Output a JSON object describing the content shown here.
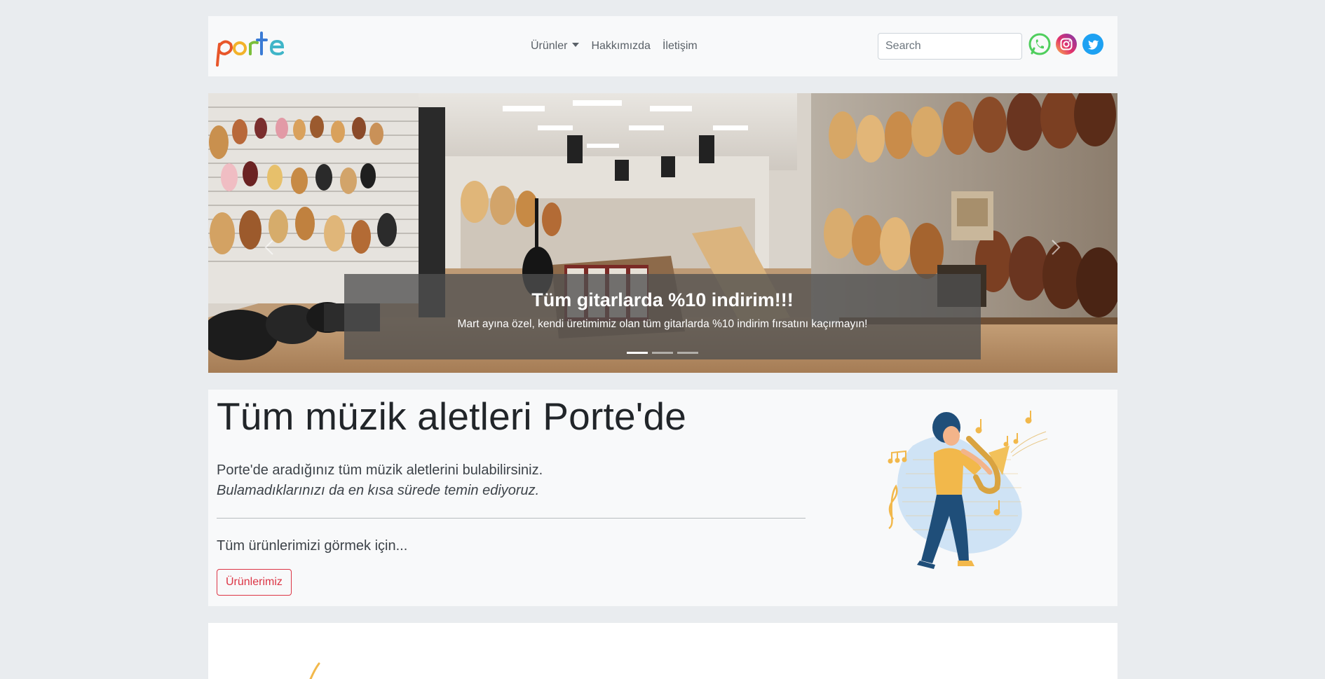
{
  "brand": {
    "logo_text": "Porte"
  },
  "nav": {
    "items": [
      {
        "label": "Ürünler",
        "dropdown": true
      },
      {
        "label": "Hakkımızda",
        "dropdown": false
      },
      {
        "label": "İletişim",
        "dropdown": false
      }
    ],
    "search_placeholder": "Search",
    "social": [
      "whatsapp-icon",
      "instagram-icon",
      "twitter-icon"
    ]
  },
  "carousel": {
    "caption_title": "Tüm gitarlarda %10 indirim!!!",
    "caption_text": "Mart ayına özel, kendi üretimimiz olan tüm gitarlarda %10 indirim fırsatını kaçırmayın!",
    "slide_count": 3,
    "active_index": 0
  },
  "jumbotron": {
    "title": "Tüm müzik aletleri Porte'de",
    "lead1": "Porte'de aradığınız tüm müzik aletlerini bulabilirsiniz.",
    "lead2": "Bulamadıklarınızı da en kısa sürede temin ediyoruz.",
    "lead3": "Tüm ürünlerimizi görmek için...",
    "button_label": "Ürünlerimiz"
  },
  "colors": {
    "accent": "#dc3545",
    "whatsapp": "#4fce5d",
    "twitter": "#1da1f2"
  }
}
